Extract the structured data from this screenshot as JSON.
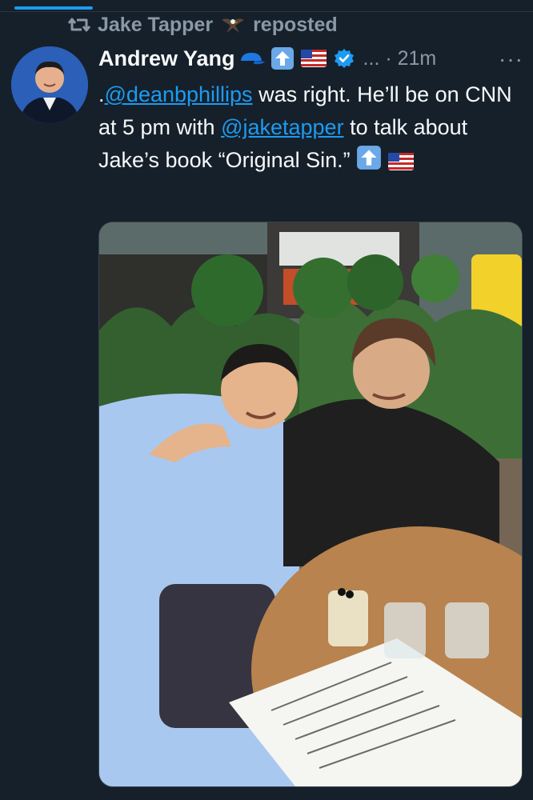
{
  "repost": {
    "user": "Jake Tapper",
    "label": "reposted",
    "icon": "repost-icon",
    "badge_icon": "eagle-icon"
  },
  "tweet": {
    "author": "Andrew Yang",
    "time": "21m",
    "meta_separator": "... ·",
    "more_label": "···",
    "text": {
      "prefix": ".",
      "mention1": "@deanbphillips",
      "part1": " was right.  He’ll be on CNN at 5 pm with ",
      "mention2": "@jaketapper",
      "part2": " to talk about Jake’s book “Original Sin.”  "
    },
    "icons": [
      "cap-icon",
      "arrow-up-emoji",
      "us-flag-emoji",
      "verified-badge-icon",
      "more-icon"
    ]
  },
  "colors": {
    "background": "#15202b",
    "text": "#f7f9f9",
    "secondary": "#8b98a5",
    "accent": "#1d9bf0"
  }
}
